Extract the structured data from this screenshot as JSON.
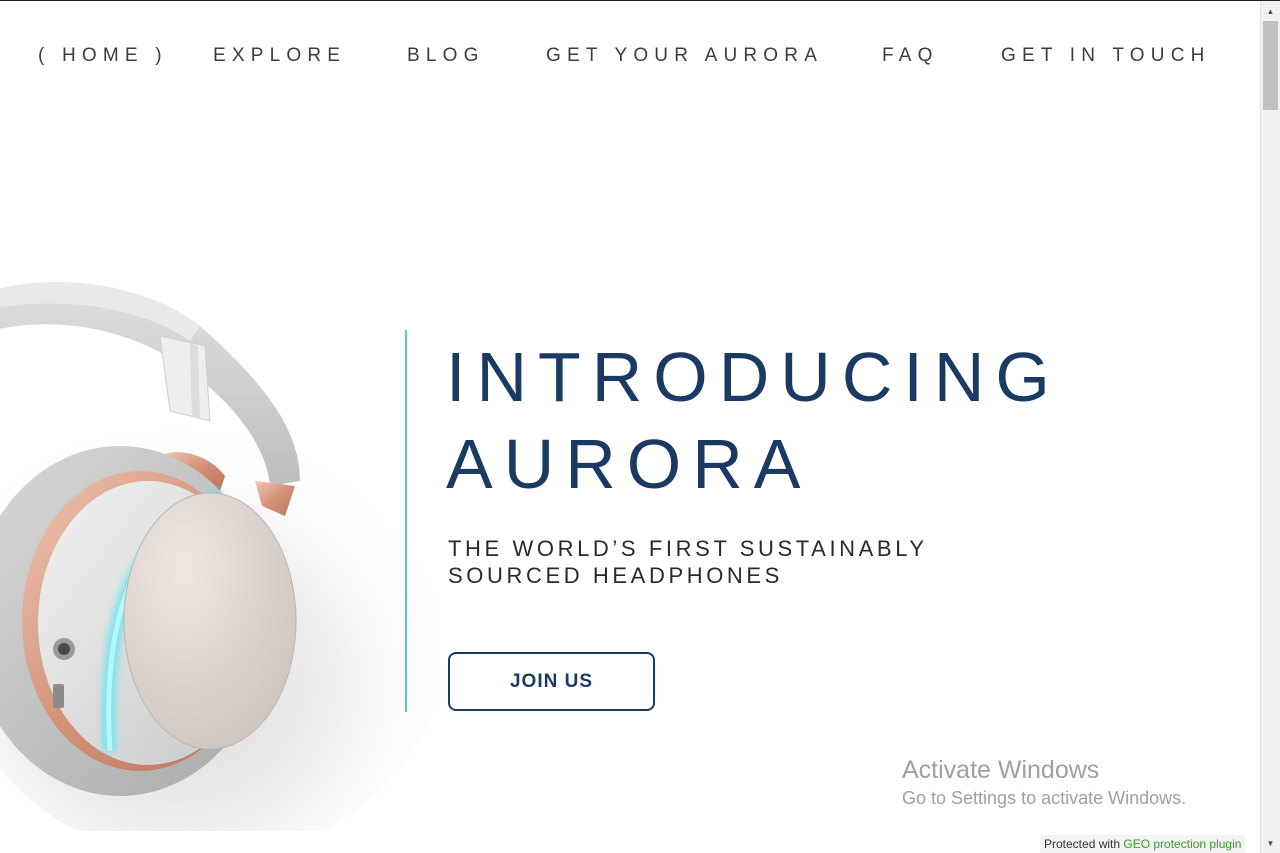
{
  "nav": {
    "home": "( HOME )",
    "explore": "EXPLORE",
    "blog": "BLOG",
    "get_aurora": "GET YOUR AURORA",
    "faq": "FAQ",
    "contact": "GET IN TOUCH"
  },
  "hero": {
    "title_line1": "INTRODUCING",
    "title_line2": "AURORA",
    "subtitle_line1": "THE WORLD’S FIRST SUSTAINABLY",
    "subtitle_line2": "SOURCED HEADPHONES",
    "cta_label": "JOIN US",
    "image": "white-rose-gold-headphones-with-cyan-light-ring"
  },
  "watermark": {
    "title": "Activate Windows",
    "subtitle": "Go to Settings to activate Windows."
  },
  "badge": {
    "prefix": "Protected with ",
    "plugin": "GEO protection plugin"
  },
  "scrollbar": {
    "up_icon": "▲",
    "down_icon": "▼"
  },
  "colors": {
    "title": "#1b3a63",
    "accent_line": "#5cc8d2",
    "button_border": "#1b3a63",
    "light_ring": "#5fe6f0",
    "rose_gold": "#d9a48d"
  }
}
